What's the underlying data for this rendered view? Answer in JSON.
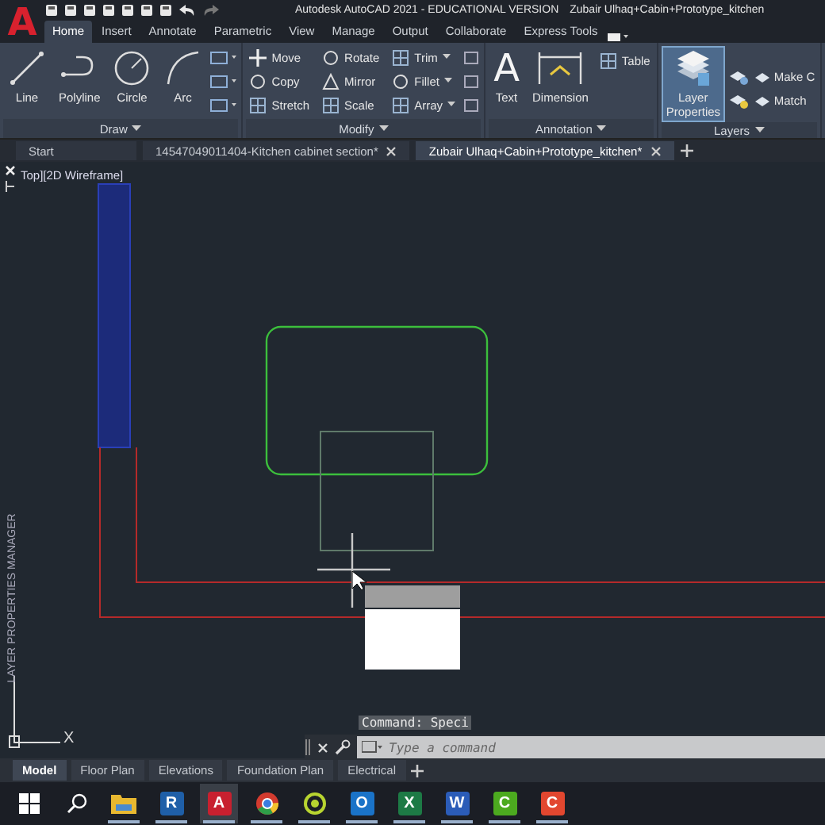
{
  "app_logo": {
    "glyph": "A"
  },
  "title_bar": {
    "title": "Autodesk AutoCAD 2021 - EDUCATIONAL VERSION",
    "document": "Zubair Ulhaq+Cabin+Prototype_kitchen"
  },
  "ribbon_tabs": [
    {
      "label": "Home",
      "selected": true
    },
    {
      "label": "Insert",
      "selected": false
    },
    {
      "label": "Annotate",
      "selected": false
    },
    {
      "label": "Parametric",
      "selected": false
    },
    {
      "label": "View",
      "selected": false
    },
    {
      "label": "Manage",
      "selected": false
    },
    {
      "label": "Output",
      "selected": false
    },
    {
      "label": "Collaborate",
      "selected": false
    },
    {
      "label": "Express Tools",
      "selected": false
    }
  ],
  "panels": [
    {
      "kind": "draw",
      "title": "Draw",
      "tools": [
        {
          "kind": "line",
          "label": "Line",
          "selected": false
        },
        {
          "kind": "polyline",
          "label": "Polyline",
          "selected": false
        },
        {
          "kind": "circle",
          "label": "Circle",
          "selected": false
        },
        {
          "kind": "arc",
          "label": "Arc",
          "selected": false
        }
      ]
    },
    {
      "kind": "modify",
      "title": "Modify",
      "small": [
        {
          "kind": "move",
          "label": "Move",
          "dropdown": false
        },
        {
          "kind": "copy",
          "label": "Copy",
          "dropdown": false
        },
        {
          "kind": "stretch",
          "label": "Stretch",
          "dropdown": false
        },
        {
          "kind": "rotate",
          "label": "Rotate",
          "dropdown": false
        },
        {
          "kind": "mirror",
          "label": "Mirror",
          "dropdown": false
        },
        {
          "kind": "scale",
          "label": "Scale",
          "dropdown": false
        },
        {
          "kind": "trim",
          "label": "Trim",
          "dropdown": true
        },
        {
          "kind": "fillet",
          "label": "Fillet",
          "dropdown": true
        },
        {
          "kind": "array",
          "label": "Array",
          "dropdown": true
        }
      ]
    },
    {
      "kind": "annotation",
      "title": "Annotation",
      "tools": [
        {
          "kind": "text",
          "label": "Text",
          "glyph": "A",
          "selected": false
        },
        {
          "kind": "dimension",
          "label": "Dimension",
          "selected": false
        }
      ],
      "small": [
        {
          "kind": "table",
          "label": "Table",
          "dropdown": false
        }
      ]
    },
    {
      "kind": "layers",
      "title": "Layers",
      "tools": [
        {
          "kind": "layers",
          "label": "Layer Properties",
          "selected": true
        }
      ],
      "small": [
        {
          "kind": "make",
          "label": "Make C",
          "dropdown": false
        },
        {
          "kind": "match",
          "label": "Match",
          "dropdown": false
        }
      ]
    }
  ],
  "file_tabs": [
    {
      "label": "Start",
      "closable": false,
      "selected": false
    },
    {
      "label": "14547049011404-Kitchen cabinet section*",
      "closable": true,
      "selected": false
    },
    {
      "label": "Zubair Ulhaq+Cabin+Prototype_kitchen*",
      "closable": true,
      "selected": true
    }
  ],
  "viewport": {
    "view_label": "Top][2D Wireframe]",
    "side_palette": "LAYER PROPERTIES MANAGER",
    "ucs_axis": "X"
  },
  "command_line": {
    "history": "Command: Speci",
    "placeholder": "Type a command"
  },
  "layout_tabs": [
    {
      "label": "Model",
      "selected": true
    },
    {
      "label": "Floor Plan",
      "selected": false
    },
    {
      "label": "Elevations",
      "selected": false
    },
    {
      "label": "Foundation Plan",
      "selected": false
    },
    {
      "label": "Electrical",
      "selected": false
    }
  ],
  "taskbar": [
    {
      "kind": "windows",
      "selected": false,
      "running": false
    },
    {
      "kind": "search",
      "selected": false,
      "running": false
    },
    {
      "kind": "folder",
      "selected": false,
      "running": true
    },
    {
      "kind": "tile",
      "glyph": "R",
      "color": "#1f5fa8",
      "selected": false,
      "running": true
    },
    {
      "kind": "tile",
      "glyph": "A",
      "color": "#c8202f",
      "selected": true,
      "running": true
    },
    {
      "kind": "chrome",
      "selected": false,
      "running": true
    },
    {
      "kind": "ring",
      "selected": false,
      "running": true
    },
    {
      "kind": "tile",
      "glyph": "O",
      "color": "#1a73c8",
      "selected": false,
      "running": true
    },
    {
      "kind": "tile",
      "glyph": "X",
      "color": "#1d7a45",
      "selected": false,
      "running": true
    },
    {
      "kind": "tile",
      "glyph": "W",
      "color": "#2b5cb8",
      "selected": false,
      "running": true
    },
    {
      "kind": "tile",
      "glyph": "C",
      "color": "#4caa1f",
      "selected": false,
      "running": true
    },
    {
      "kind": "tile",
      "glyph": "C",
      "color": "#e2472f",
      "selected": false,
      "running": true
    }
  ]
}
